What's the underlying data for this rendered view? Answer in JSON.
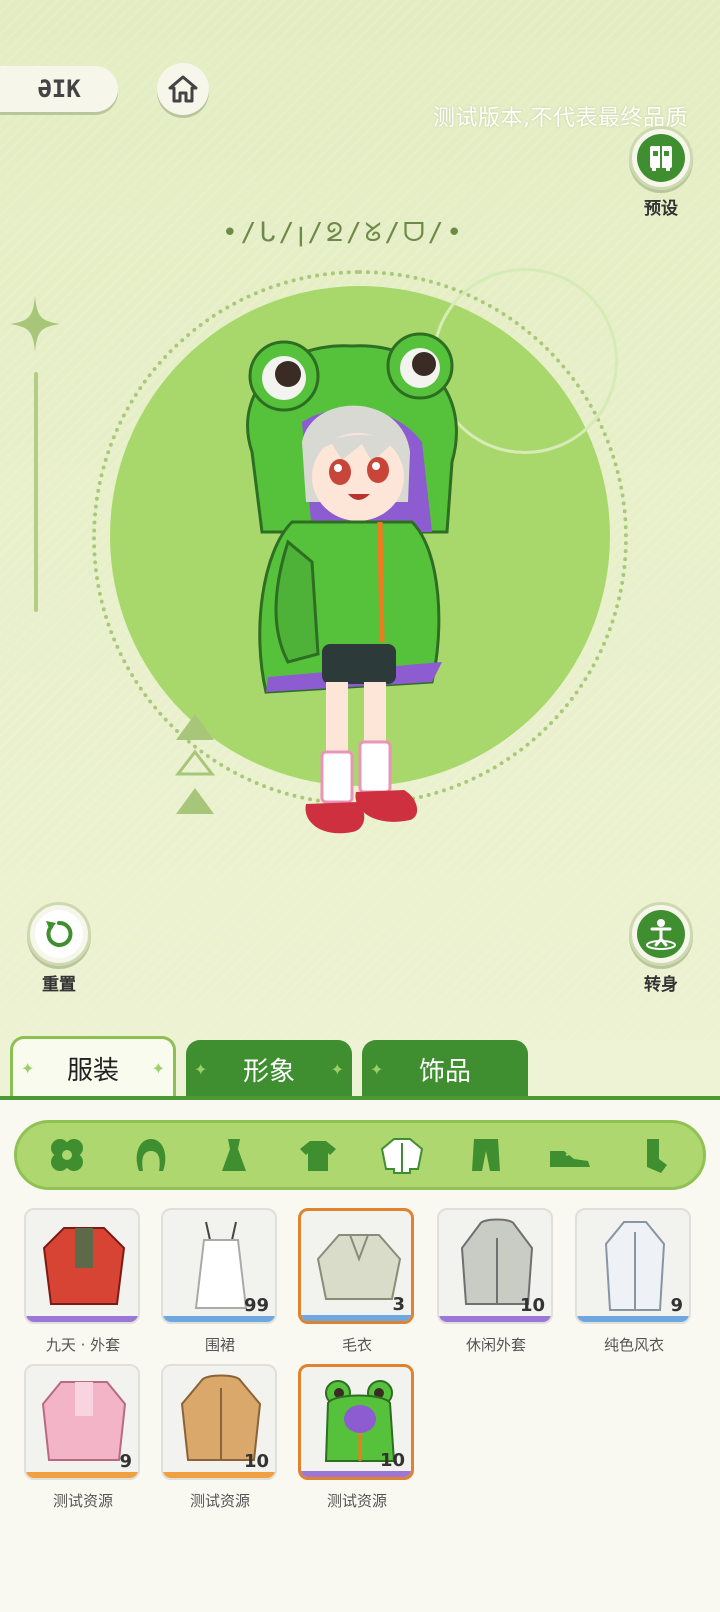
{
  "top": {
    "back_label": "ƏIK",
    "test_notice": "测试版本,不代表最终品质"
  },
  "right_buttons": {
    "preset_label": "预设",
    "turn_label": "转身"
  },
  "left_buttons": {
    "reset_label": "重置"
  },
  "stage": {
    "title_glyphs": "•/ᒐ/ꞁ/ᘖ/ᘜ/ᗜ/•"
  },
  "tabs": [
    {
      "label": "服装",
      "active": true
    },
    {
      "label": "形象",
      "active": false
    },
    {
      "label": "饰品",
      "active": false
    }
  ],
  "categories": [
    {
      "icon": "clover-icon"
    },
    {
      "icon": "hair-icon"
    },
    {
      "icon": "dress-icon"
    },
    {
      "icon": "tshirt-icon"
    },
    {
      "icon": "jacket-icon",
      "active": true
    },
    {
      "icon": "pants-icon"
    },
    {
      "icon": "shoe-icon"
    },
    {
      "icon": "sock-icon"
    }
  ],
  "items": [
    {
      "label": "九天 · 外套",
      "count": "",
      "bar_color": "#9b78d8",
      "color": "#d84434",
      "selected": false
    },
    {
      "label": "围裙",
      "count": "99",
      "bar_color": "#6fa8e0",
      "color": "#f4f4ee",
      "selected": false
    },
    {
      "label": "毛衣",
      "count": "3",
      "bar_color": "#6fa8e0",
      "color": "#d9dcc8",
      "selected": true
    },
    {
      "label": "休闲外套",
      "count": "10",
      "bar_color": "#9b78d8",
      "color": "#c9cbc5",
      "selected": false
    },
    {
      "label": "纯色风衣",
      "count": "9",
      "bar_color": "#6fa8e0",
      "color": "#eef2f6",
      "selected": false
    },
    {
      "label": "测试资源",
      "count": "9",
      "bar_color": "#f0a040",
      "color": "#f4b4c8",
      "selected": false
    },
    {
      "label": "测试资源",
      "count": "10",
      "bar_color": "#f0a040",
      "color": "#d9a86a",
      "selected": false
    },
    {
      "label": "测试资源",
      "count": "10",
      "bar_color": "#9b78d8",
      "color": "#56c23c",
      "selected": true
    }
  ],
  "colors": {
    "accent_green": "#3f8f31",
    "light_green": "#a8d86c",
    "selected_orange": "#e0822e"
  }
}
